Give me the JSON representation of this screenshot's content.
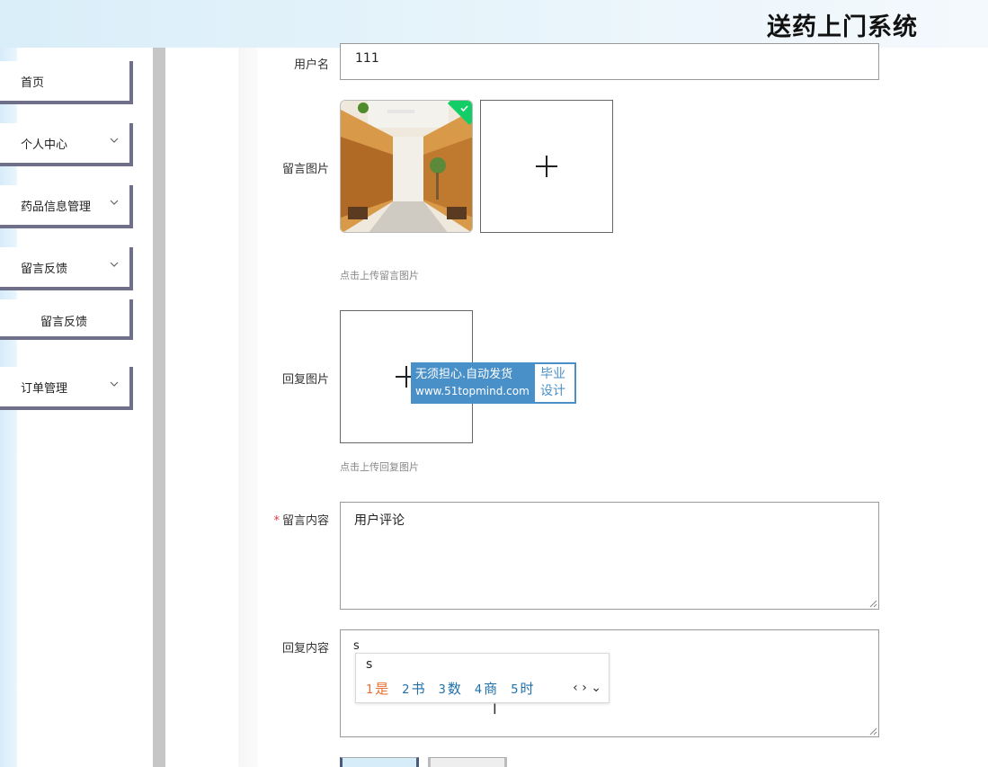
{
  "header": {
    "title": "送药上门系统"
  },
  "sidebar": {
    "items": [
      {
        "label": "首页",
        "has_arrow": false
      },
      {
        "label": "个人中心",
        "has_arrow": true
      },
      {
        "label": "药品信息管理",
        "has_arrow": true
      },
      {
        "label": "留言反馈",
        "has_arrow": true
      },
      {
        "label": "留言反馈",
        "has_arrow": false,
        "submenu": true
      },
      {
        "label": "订单管理",
        "has_arrow": true
      }
    ]
  },
  "form": {
    "username": {
      "label": "用户名",
      "value": "111"
    },
    "message_image": {
      "label": "留言图片",
      "hint": "点击上传留言图片"
    },
    "reply_image": {
      "label": "回复图片",
      "hint": "点击上传回复图片"
    },
    "message_content": {
      "label": "留言内容",
      "required_mark": "*",
      "value": "用户评论"
    },
    "reply_content": {
      "label": "回复内容",
      "value": "s"
    }
  },
  "watermark": {
    "line1": "无须担心.自动发货",
    "line2": "www.51topmind.com",
    "badge_line1": "毕业",
    "badge_line2": "设计"
  },
  "ime": {
    "typed": "s",
    "candidates": [
      {
        "num": "1",
        "text": "是"
      },
      {
        "num": "2",
        "text": "书"
      },
      {
        "num": "3",
        "text": "数"
      },
      {
        "num": "4",
        "text": "商"
      },
      {
        "num": "5",
        "text": "时"
      }
    ],
    "nav": "‹ › ⌄"
  },
  "colors": {
    "accent": "#4a90c8",
    "success": "#13ce66",
    "sidebar_border": "#6f6f8a",
    "ime_first": "#e87030"
  }
}
